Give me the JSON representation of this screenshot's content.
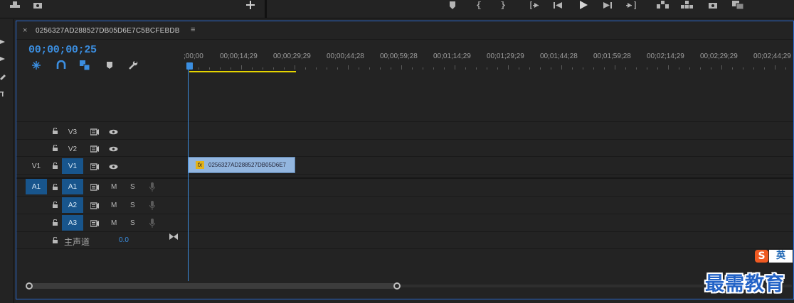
{
  "sequence": {
    "tab_close": "×",
    "tab_title": "0256327AD288527DB05D6E7C5BCFEBDB",
    "tab_menu": "≡",
    "timecode": "00;00;00;25"
  },
  "ruler": {
    "labels": [
      ";00;00",
      "00;00;14;29",
      "00;00;29;29",
      "00;00;44;28",
      "00;00;59;28",
      "00;01;14;29",
      "00;01;29;29",
      "00;01;44;28",
      "00;01;59;28",
      "00;02;14;29",
      "00;02;29;29",
      "00;02;44;29"
    ]
  },
  "tracks": {
    "video": [
      {
        "name": "V3",
        "source": ""
      },
      {
        "name": "V2",
        "source": ""
      },
      {
        "name": "V1",
        "source": "V1"
      }
    ],
    "audio": [
      {
        "name": "A1",
        "source": "A1",
        "mute": "M",
        "solo": "S"
      },
      {
        "name": "A2",
        "source": "",
        "mute": "M",
        "solo": "S"
      },
      {
        "name": "A3",
        "source": "",
        "mute": "M",
        "solo": "S"
      }
    ],
    "master": {
      "label": "主声道",
      "value": "0.0"
    }
  },
  "clip": {
    "fx_label": "fx",
    "name": "0256327AD288527DB05D6E7"
  },
  "watermark": {
    "badge_s": "S",
    "badge_lang": "英",
    "text": "最需教育"
  },
  "colors": {
    "accent": "#3b8ee0",
    "track_target": "#18558c",
    "clip": "#93b6df",
    "work_area": "#e5d400",
    "watermark": "#2363c7"
  }
}
